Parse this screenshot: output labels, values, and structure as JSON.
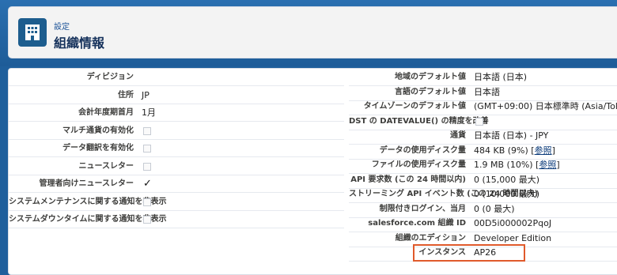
{
  "header": {
    "breadcrumb": "設定",
    "title": "組織情報",
    "icon": "building-icon"
  },
  "left_fields": [
    {
      "label": "ディビジョン",
      "value": ""
    },
    {
      "label": "住所",
      "value": "JP"
    },
    {
      "label": "会計年度期首月",
      "value": "1月"
    },
    {
      "label": "マルチ通貨の有効化",
      "checkbox": false
    },
    {
      "label": "データ翻訳を有効化",
      "checkbox": false
    },
    {
      "label": "ニュースレター",
      "checkbox": false
    },
    {
      "label": "管理者向けニュースレター",
      "checkbox": true
    },
    {
      "label": "システムメンテナンスに関する通知を非表示",
      "checkbox": false
    },
    {
      "label": "システムダウンタイムに関する通知を非表示",
      "checkbox": false
    }
  ],
  "right_fields": [
    {
      "label": "地域のデフォルト値",
      "value": "日本語 (日本)"
    },
    {
      "label": "言語のデフォルト値",
      "value": "日本語"
    },
    {
      "label": "タイムゾーンのデフォルト値",
      "value": "(GMT+09:00) 日本標準時 (Asia/Tokyo)"
    },
    {
      "label": "DST の DATEVALUE() の精度を改善",
      "checkbox": false
    },
    {
      "label": "通貨",
      "value": "日本語 (日本) - JPY"
    },
    {
      "label": "データの使用ディスク量",
      "value": "484 KB (9%) [",
      "link": "参照",
      "suffix": "]"
    },
    {
      "label": "ファイルの使用ディスク量",
      "value": "1.9 MB (10%) [",
      "link": "参照",
      "suffix": "]"
    },
    {
      "label": "API 要求数 (この 24 時間以内)",
      "value": "0 (15,000 最大)"
    },
    {
      "label": "ストリーミング API イベント数 (この 24 時間以内)",
      "value": "0 (10,000 最大)"
    },
    {
      "label": "制限付きログイン、当月",
      "value": "0 (0 最大)"
    },
    {
      "label": "salesforce.com 組織 ID",
      "value": "00D5i000002PqoJ"
    },
    {
      "label": "組織のエディション",
      "value": "Developer Edition"
    },
    {
      "label": "インスタンス",
      "value": "AP26"
    }
  ],
  "colors": {
    "accent": "#1f5f9c",
    "highlight_box": "#e05a2b"
  }
}
